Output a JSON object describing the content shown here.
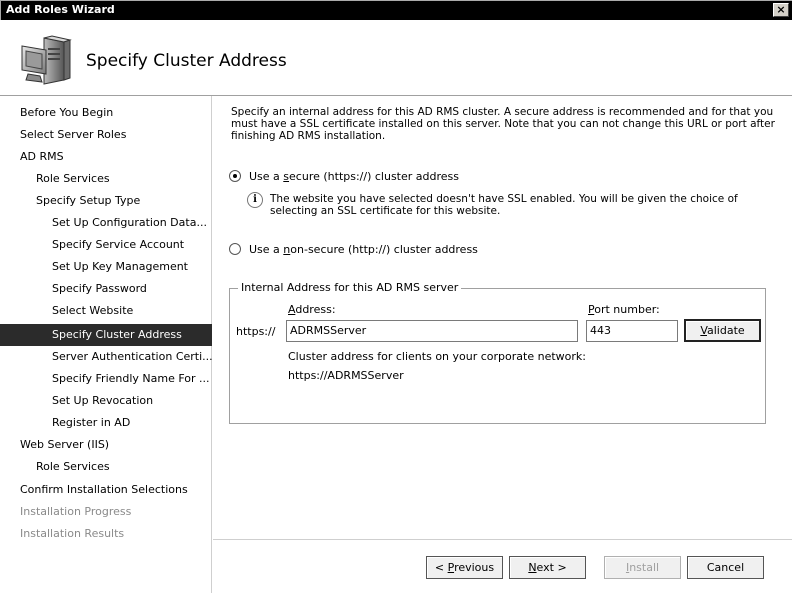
{
  "window": {
    "title": "Add Roles Wizard",
    "close_glyph": "×"
  },
  "header": {
    "title": "Specify Cluster Address",
    "icon": "server-computer-icon"
  },
  "sidebar": {
    "items": [
      {
        "label": "Before You Begin",
        "level": 0,
        "state": "normal"
      },
      {
        "label": "Select Server Roles",
        "level": 0,
        "state": "normal"
      },
      {
        "label": "AD RMS",
        "level": 0,
        "state": "normal"
      },
      {
        "label": "Role Services",
        "level": 1,
        "state": "normal"
      },
      {
        "label": "Specify Setup Type",
        "level": 1,
        "state": "normal"
      },
      {
        "label": "Set Up Configuration Data...",
        "level": 2,
        "state": "normal"
      },
      {
        "label": "Specify Service Account",
        "level": 2,
        "state": "normal"
      },
      {
        "label": "Set Up Key Management",
        "level": 2,
        "state": "normal"
      },
      {
        "label": "Specify Password",
        "level": 2,
        "state": "normal"
      },
      {
        "label": "Select Website",
        "level": 2,
        "state": "normal"
      },
      {
        "label": "Specify Cluster Address",
        "level": 2,
        "state": "selected"
      },
      {
        "label": "Server Authentication Certi...",
        "level": 2,
        "state": "normal"
      },
      {
        "label": "Specify Friendly Name For ...",
        "level": 2,
        "state": "normal"
      },
      {
        "label": "Set Up Revocation",
        "level": 2,
        "state": "normal"
      },
      {
        "label": "Register in AD",
        "level": 2,
        "state": "normal"
      },
      {
        "label": "Web Server (IIS)",
        "level": 0,
        "state": "normal"
      },
      {
        "label": "Role Services",
        "level": 1,
        "state": "normal"
      },
      {
        "label": "Confirm Installation Selections",
        "level": 0,
        "state": "normal"
      },
      {
        "label": "Installation Progress",
        "level": 0,
        "state": "disabled"
      },
      {
        "label": "Installation Results",
        "level": 0,
        "state": "disabled"
      }
    ]
  },
  "main": {
    "intro": "Specify an internal address for this AD RMS cluster. A secure address is recommended and for that you must have a SSL certificate installed on this server. Note that you can not change this URL or port after finishing AD RMS installation.",
    "secure_option": {
      "pre": "Use a ",
      "accel": "s",
      "post": "ecure (https://) cluster address",
      "checked": true
    },
    "info_text": "The website you have selected doesn't have SSL enabled. You will be given the choice of selecting an SSL certificate for this website.",
    "nonsecure_option": {
      "pre": "Use a ",
      "accel": "n",
      "post": "on-secure (http://) cluster address",
      "checked": false
    },
    "group": {
      "legend": "Internal Address for this AD RMS server",
      "address_label_accel": "A",
      "address_label_rest": "ddress:",
      "port_label_accel": "P",
      "port_label_rest": "ort number:",
      "scheme": "https://",
      "address_value": "ADRMSServer",
      "port_value": "443",
      "validate_accel": "V",
      "validate_rest": "alidate",
      "cluster_caption": "Cluster address for clients on your corporate network:",
      "cluster_value": "https://ADRMSServer"
    }
  },
  "footer": {
    "previous": {
      "pre": "< ",
      "accel": "P",
      "post": "revious"
    },
    "next": {
      "accel": "N",
      "post": "ext >"
    },
    "install": {
      "accel": "I",
      "post": "nstall"
    },
    "cancel": "Cancel"
  }
}
